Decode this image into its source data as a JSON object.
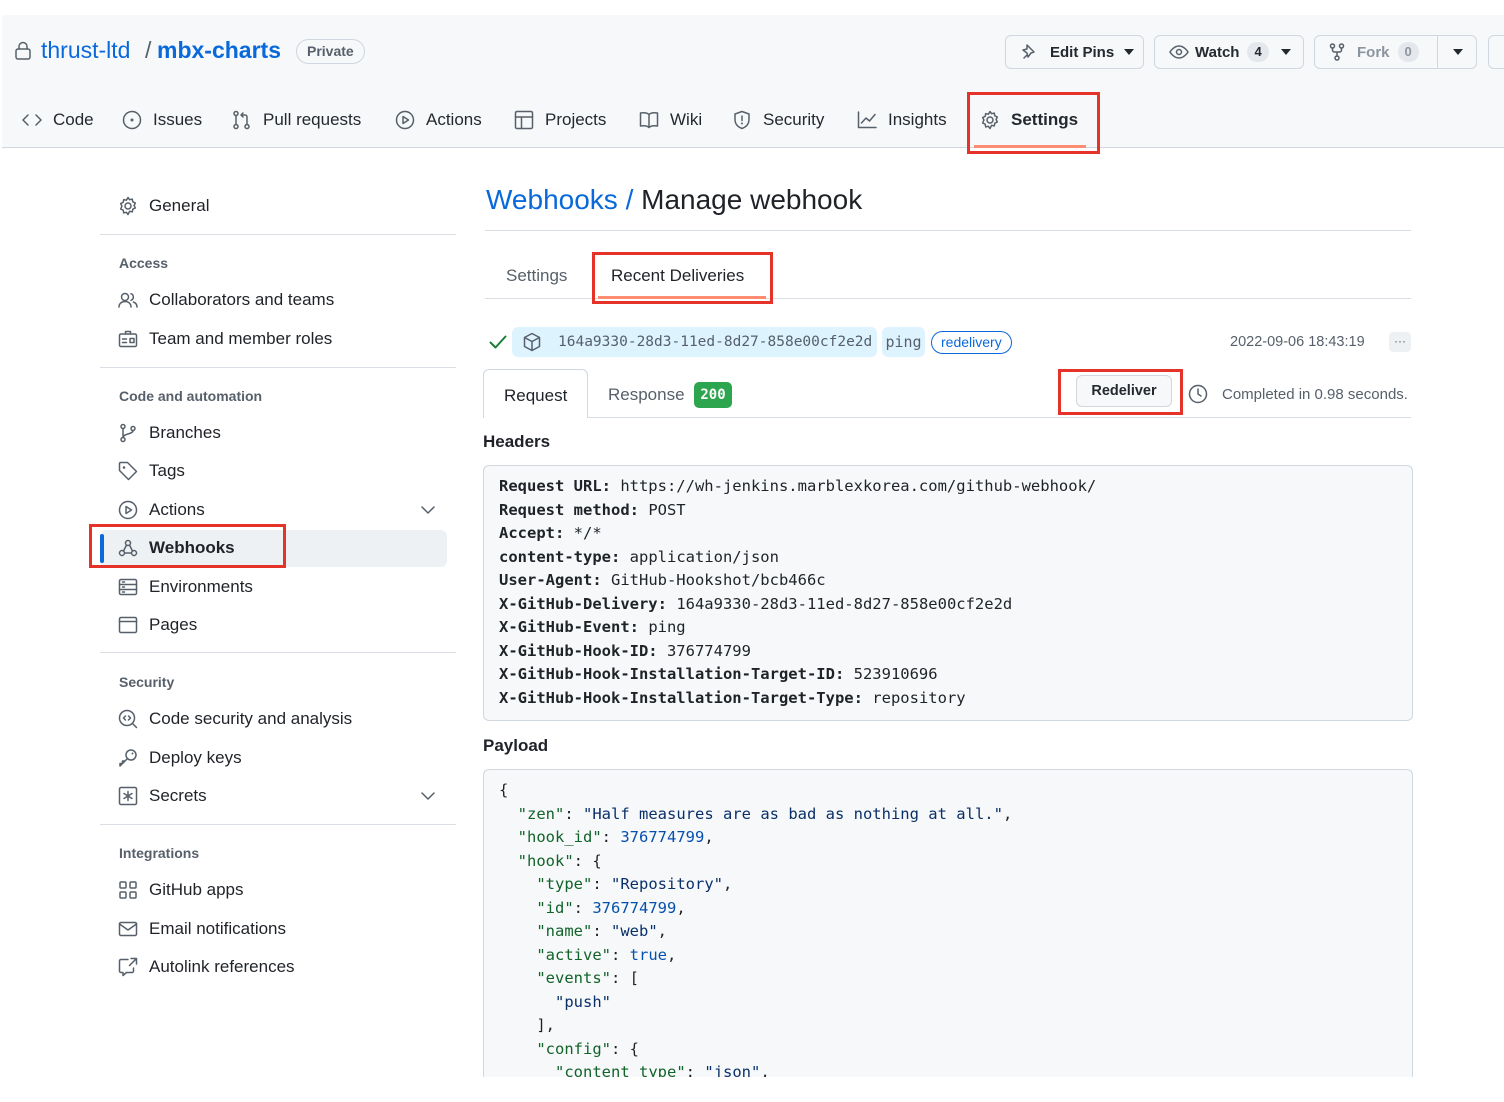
{
  "repo": {
    "owner": "thrust-ltd",
    "separator": "/",
    "name": "mbx-charts",
    "visibility": "Private"
  },
  "header_buttons": {
    "edit_pins": "Edit Pins",
    "watch": "Watch",
    "watch_count": "4",
    "fork": "Fork",
    "fork_count": "0"
  },
  "tabs": [
    "Code",
    "Issues",
    "Pull requests",
    "Actions",
    "Projects",
    "Wiki",
    "Security",
    "Insights",
    "Settings"
  ],
  "sidebar": {
    "general": "General",
    "sections": [
      {
        "title": "Access",
        "items": [
          "Collaborators and teams",
          "Team and member roles"
        ]
      },
      {
        "title": "Code and automation",
        "items": [
          "Branches",
          "Tags",
          "Actions",
          "Webhooks",
          "Environments",
          "Pages"
        ]
      },
      {
        "title": "Security",
        "items": [
          "Code security and analysis",
          "Deploy keys",
          "Secrets"
        ]
      },
      {
        "title": "Integrations",
        "items": [
          "GitHub apps",
          "Email notifications",
          "Autolink references"
        ]
      }
    ],
    "active": "Webhooks"
  },
  "page": {
    "breadcrumb_link": "Webhooks",
    "breadcrumb_sep": "/",
    "title": "Manage webhook",
    "subtabs": [
      "Settings",
      "Recent Deliveries"
    ]
  },
  "delivery": {
    "guid": "164a9330-28d3-11ed-8d27-858e00cf2e2d",
    "event": "ping",
    "label": "redelivery",
    "timestamp": "2022-09-06 18:43:19",
    "more": "···",
    "req_tab": "Request",
    "resp_tab": "Response",
    "resp_code": "200",
    "redeliver": "Redeliver",
    "completed": "Completed in 0.98 seconds."
  },
  "headers_title": "Headers",
  "headers": [
    {
      "k": "Request URL:",
      "v": "https://wh-jenkins.marblexkorea.com/github-webhook/"
    },
    {
      "k": "Request method:",
      "v": "POST"
    },
    {
      "k": "Accept:",
      "v": "*/*"
    },
    {
      "k": "content-type:",
      "v": "application/json"
    },
    {
      "k": "User-Agent:",
      "v": "GitHub-Hookshot/bcb466c"
    },
    {
      "k": "X-GitHub-Delivery:",
      "v": "164a9330-28d3-11ed-8d27-858e00cf2e2d"
    },
    {
      "k": "X-GitHub-Event:",
      "v": "ping"
    },
    {
      "k": "X-GitHub-Hook-ID:",
      "v": "376774799"
    },
    {
      "k": "X-GitHub-Hook-Installation-Target-ID:",
      "v": "523910696"
    },
    {
      "k": "X-GitHub-Hook-Installation-Target-Type:",
      "v": "repository"
    }
  ],
  "payload_title": "Payload",
  "payload_lines": [
    "{",
    "  \"zen\": \"Half measures are as bad as nothing at all.\",",
    "  \"hook_id\": 376774799,",
    "  \"hook\": {",
    "    \"type\": \"Repository\",",
    "    \"id\": 376774799,",
    "    \"name\": \"web\",",
    "    \"active\": true,",
    "    \"events\": [",
    "      \"push\"",
    "    ],",
    "    \"config\": {",
    "      \"content_type\": \"json\","
  ]
}
